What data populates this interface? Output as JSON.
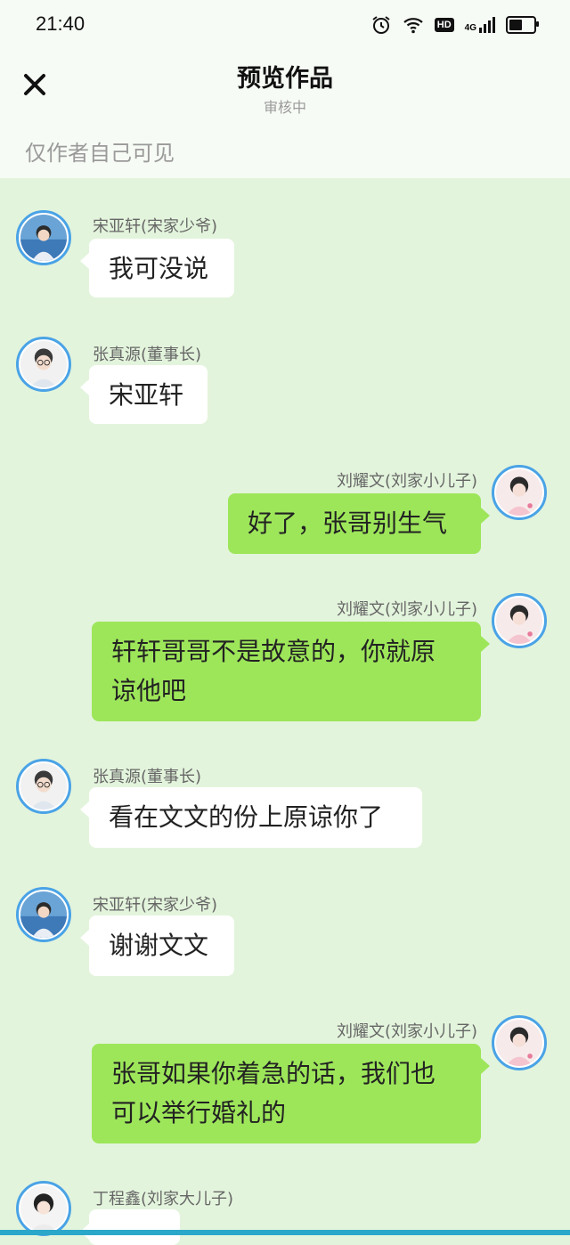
{
  "status_bar": {
    "time": "21:40",
    "network": "4G",
    "hd": "HD"
  },
  "header": {
    "title": "预览作品",
    "subtitle": "审核中",
    "visibility_note": "仅作者自己可见"
  },
  "colors": {
    "accent_blue": "#4aa3e6",
    "self_bubble": "#9de65a",
    "other_bubble": "#ffffff",
    "background": "#e3f4dc"
  },
  "messages": [
    {
      "side": "left",
      "name": "宋亚轩(宋家少爷)",
      "text": "我可没说",
      "avatar": "avatar-song"
    },
    {
      "side": "left",
      "name": "张真源(董事长)",
      "text": "宋亚轩",
      "avatar": "avatar-zhang"
    },
    {
      "side": "right",
      "name": "刘耀文(刘家小儿子)",
      "text": "好了，张哥别生气",
      "avatar": "avatar-liu"
    },
    {
      "side": "right",
      "name": "刘耀文(刘家小儿子)",
      "line1": "轩轩哥哥不是故意的，你就原",
      "line2": "谅他吧",
      "avatar": "avatar-liu"
    },
    {
      "side": "left",
      "name": "张真源(董事长)",
      "text": "看在文文的份上原谅你了",
      "avatar": "avatar-zhang"
    },
    {
      "side": "left",
      "name": "宋亚轩(宋家少爷)",
      "text": "谢谢文文",
      "avatar": "avatar-song"
    },
    {
      "side": "right",
      "name": "刘耀文(刘家小儿子)",
      "line1": "张哥如果你着急的话，我们也",
      "line2": "可以举行婚礼的",
      "avatar": "avatar-liu"
    },
    {
      "side": "left",
      "name": "丁程鑫(刘家大儿子)",
      "text": "",
      "avatar": "avatar-ding"
    }
  ]
}
